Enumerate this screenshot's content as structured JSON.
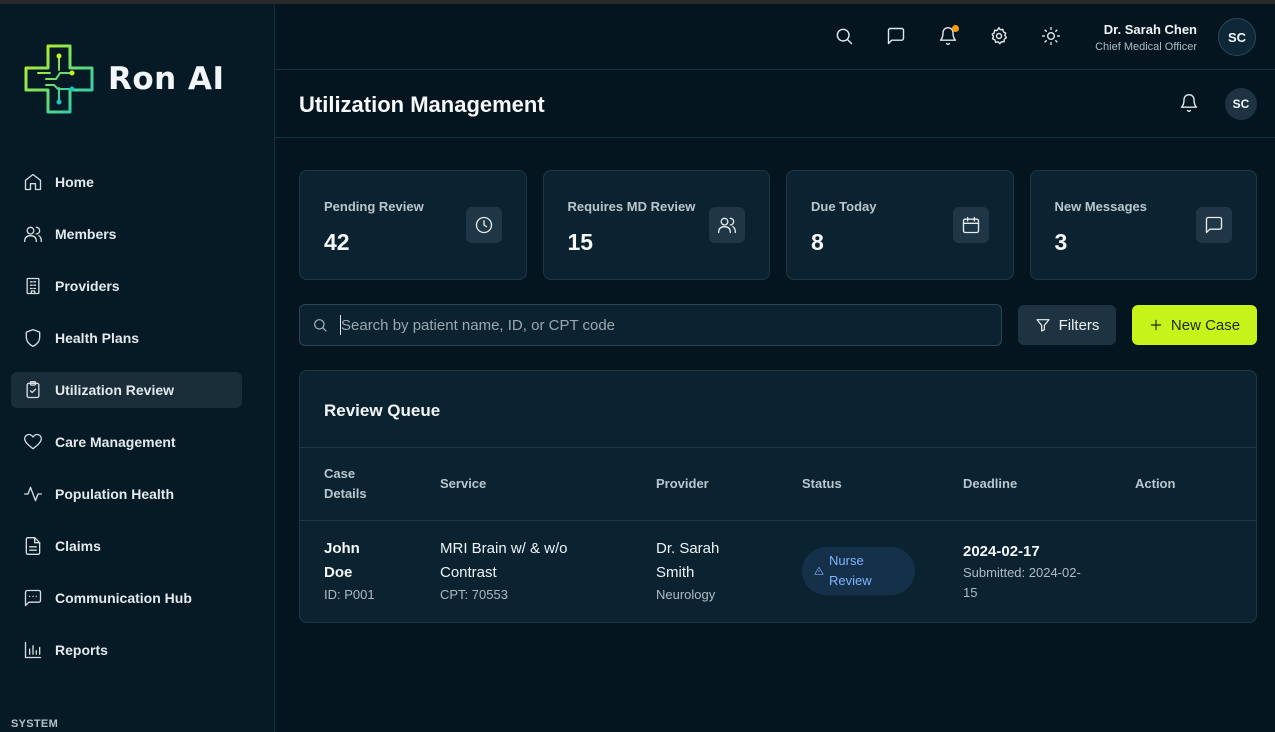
{
  "app": {
    "name": "Ron AI"
  },
  "sidebar": {
    "items": [
      {
        "label": "Home",
        "icon": "home-icon"
      },
      {
        "label": "Members",
        "icon": "users-icon"
      },
      {
        "label": "Providers",
        "icon": "building-icon"
      },
      {
        "label": "Health Plans",
        "icon": "shield-icon"
      },
      {
        "label": "Utilization Review",
        "icon": "clipboard-check-icon",
        "active": true
      },
      {
        "label": "Care Management",
        "icon": "heart-icon"
      },
      {
        "label": "Population Health",
        "icon": "activity-icon"
      },
      {
        "label": "Claims",
        "icon": "file-text-icon"
      },
      {
        "label": "Communication Hub",
        "icon": "message-square-icon"
      },
      {
        "label": "Reports",
        "icon": "bar-chart-icon"
      }
    ],
    "section_label": "SYSTEM"
  },
  "header": {
    "icons": [
      "search-icon",
      "message-icon",
      "bell-icon",
      "gear-icon",
      "sun-icon"
    ],
    "notification_dot_color": "#f59e0b",
    "user": {
      "name": "Dr. Sarah Chen",
      "role": "Chief Medical Officer",
      "initials": "SC"
    }
  },
  "page": {
    "title": "Utilization Management",
    "avatar_initials": "SC"
  },
  "stats": [
    {
      "label": "Pending Review",
      "value": "42",
      "icon": "clock-icon"
    },
    {
      "label": "Requires MD Review",
      "value": "15",
      "icon": "users-icon"
    },
    {
      "label": "Due Today",
      "value": "8",
      "icon": "calendar-icon"
    },
    {
      "label": "New Messages",
      "value": "3",
      "icon": "message-icon"
    }
  ],
  "toolbar": {
    "search_placeholder": "Search by patient name, ID, or CPT code",
    "search_value": "",
    "filters_label": "Filters",
    "new_case_label": "New Case",
    "accent_color": "#c6f31a"
  },
  "queue": {
    "title": "Review Queue",
    "columns": [
      "Case Details",
      "Service",
      "Provider",
      "Status",
      "Deadline",
      "Action"
    ],
    "rows": [
      {
        "name": "John Doe",
        "id": "ID: P001",
        "service": "MRI Brain w/ & w/o Contrast",
        "cpt": "CPT: 70553",
        "provider": "Dr. Sarah Smith",
        "specialty": "Neurology",
        "status": "Nurse Review",
        "deadline": "2024-02-17",
        "submitted": "Submitted: 2024-02-15"
      }
    ]
  }
}
